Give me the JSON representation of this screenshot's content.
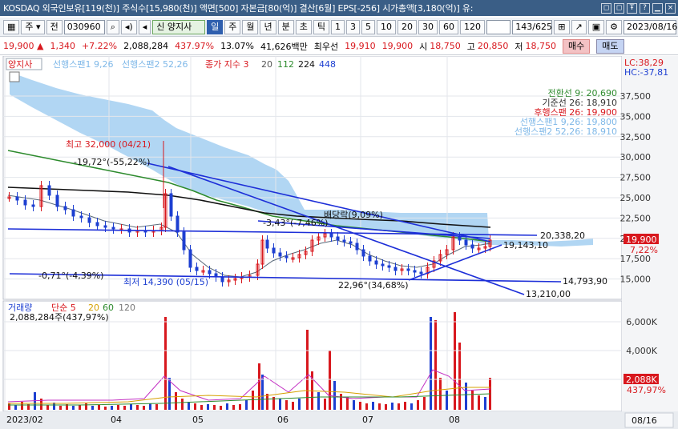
{
  "titlebar": {
    "text": "KOSDAQ 외국인보유[119(천)] 주식수[15,980(천)] 액면[500] 자본금[80(억)] 결산[6월] EPS[-256] 시가총액[3,180(억)] 유:",
    "buttons": [
      "◻",
      "◻",
      "Ŧ",
      "?",
      "▁",
      "×"
    ]
  },
  "toolbar": {
    "menu1": "주",
    "menu2": "전",
    "code": "030960",
    "stock_name": "양지사",
    "periods": [
      "일",
      "주",
      "월",
      "년",
      "분",
      "초",
      "틱"
    ],
    "intervals": [
      "1",
      "3",
      "5",
      "10",
      "20",
      "30",
      "60",
      "120"
    ],
    "page_count": "143/625",
    "date": "2023/08/16"
  },
  "quote": {
    "price": "19,900 ▲",
    "change": "1,340",
    "change_pct": "+7.22%",
    "volume": "2,088,284",
    "volume_ratio": "437.97%",
    "turnover": "13.07%",
    "amount": "41,626백만",
    "priority": "최우선",
    "ask": "19,910",
    "bid": "19,900",
    "open_label": "시",
    "open": "18,750",
    "high_label": "고",
    "high": "20,850",
    "low_label": "저",
    "low": "18,750",
    "buy": "매수",
    "sell": "매도"
  },
  "legend": {
    "name": "양지사",
    "span1": "선행스팬1 9,26",
    "span2": "선행스팬2 52,26",
    "ma_label": "종가 지수 3",
    "ma_periods": [
      "20",
      "112",
      "224",
      "448"
    ],
    "lc": "LC:38,29",
    "hc": "HC:-37,81",
    "ichimoku": [
      "전환선 9: 20,690",
      "기준선 26: 18,910",
      "후행스팬 26: 19,900",
      "선행스팬1 9,26: 19,800",
      "선행스팬2 52,26: 18,910"
    ],
    "volume_name": "거래량",
    "volume_ma": "단순 5",
    "volume_periods": [
      "20",
      "60",
      "120"
    ],
    "volume_value": "2,088,284주(437,97%)"
  },
  "annotations": {
    "high": "최고 32,000 (04/21)",
    "low": "최저 14,390 (05/15)",
    "a1": "-19,72°(-55,22%)",
    "a2": "-3,43°(-7,46%)",
    "a3": "-0,71°(-4,39%)",
    "a4": "22,96°(34,68%)",
    "a5": "배당락(9,09%)",
    "v1": "20,338,20",
    "v2": "19,143,10",
    "v3": "14,793,90",
    "v4": "13,210,00"
  },
  "price_axis": [
    "37,500",
    "35,000",
    "32,500",
    "30,000",
    "27,500",
    "25,000",
    "22,500",
    "20,000",
    "17,500",
    "15,000"
  ],
  "price_tag": "19,900",
  "pct_tag": "7,22%",
  "volume_axis": [
    "6,000K",
    "4,000K",
    "2,000K"
  ],
  "volume_tag": "2,088K",
  "volume_pct_tag": "437,97%",
  "dates": [
    "2023/02",
    "04",
    "05",
    "06",
    "07",
    "08"
  ],
  "right_date": "08/16",
  "colors": {
    "up": "#d8181e",
    "down": "#1d3fd1",
    "cloud": "#9ecbf0",
    "ma112": "#2e8b2e",
    "ma224": "#111111"
  }
}
